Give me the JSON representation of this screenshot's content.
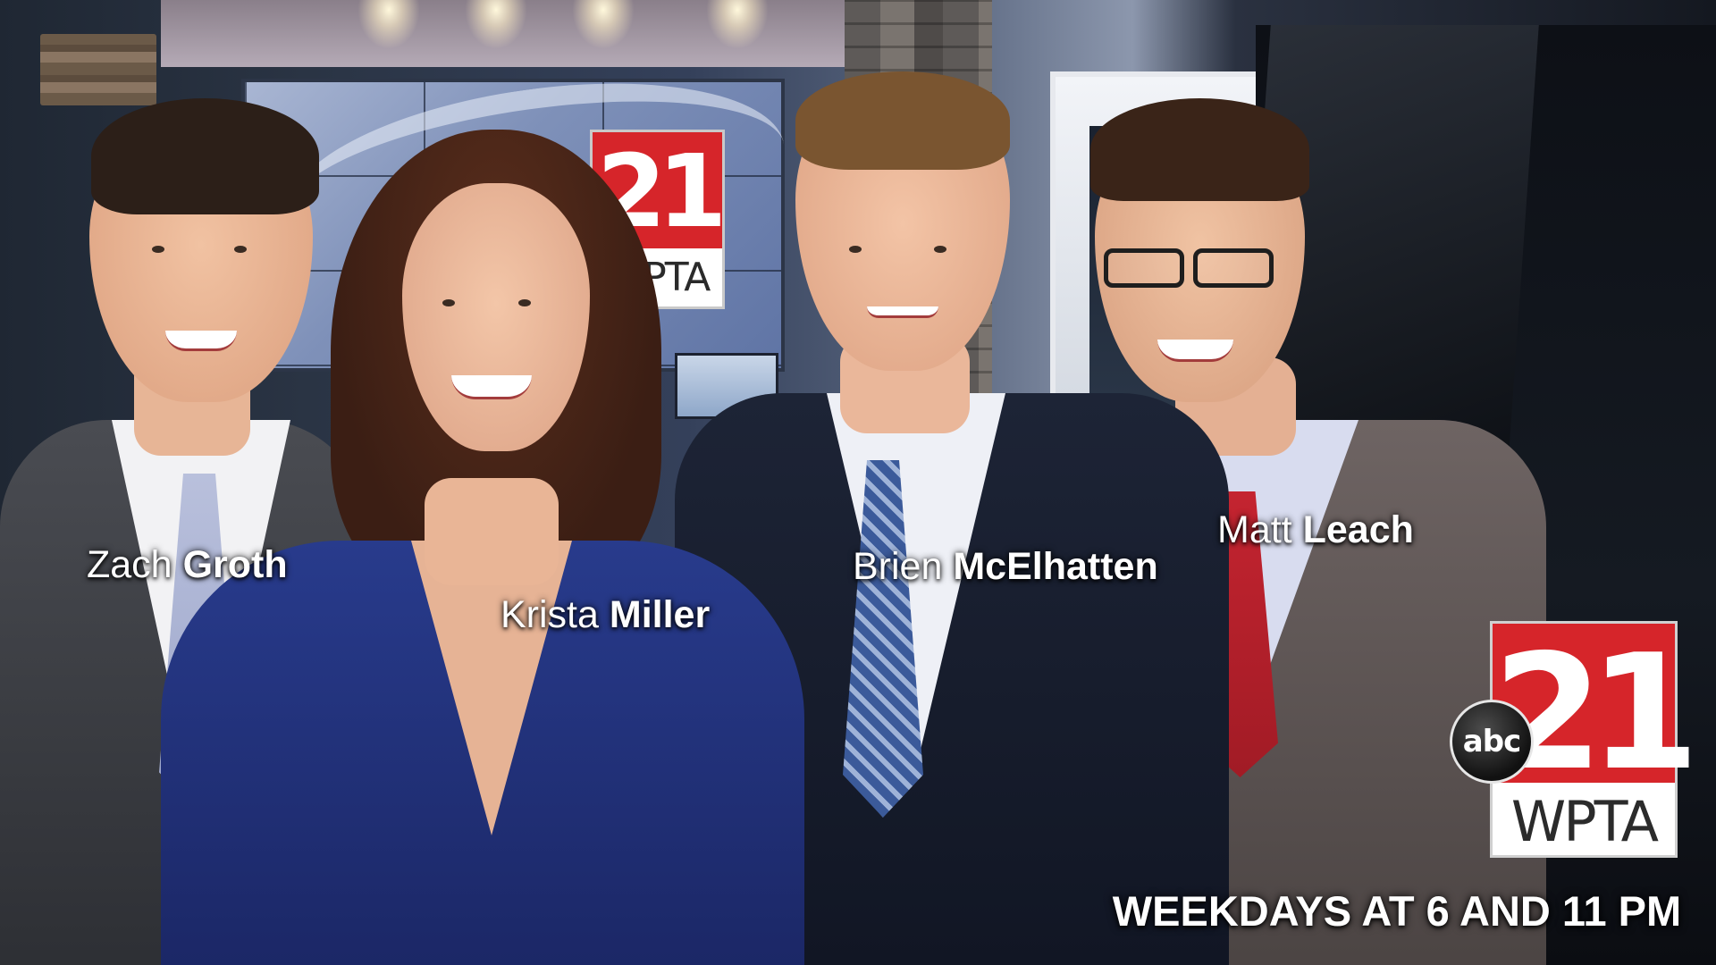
{
  "anchors": [
    {
      "first": "Zach",
      "last": "Groth"
    },
    {
      "first": "Krista",
      "last": "Miller"
    },
    {
      "first": "Brien",
      "last": "McElhatten"
    },
    {
      "first": "Matt",
      "last": "Leach"
    }
  ],
  "station": {
    "channel_number": "21",
    "call_letters": "WPTA",
    "network": "abc",
    "brand_red": "#d6252a"
  },
  "tagline": "WEEKDAYS AT 6 AND 11 PM"
}
